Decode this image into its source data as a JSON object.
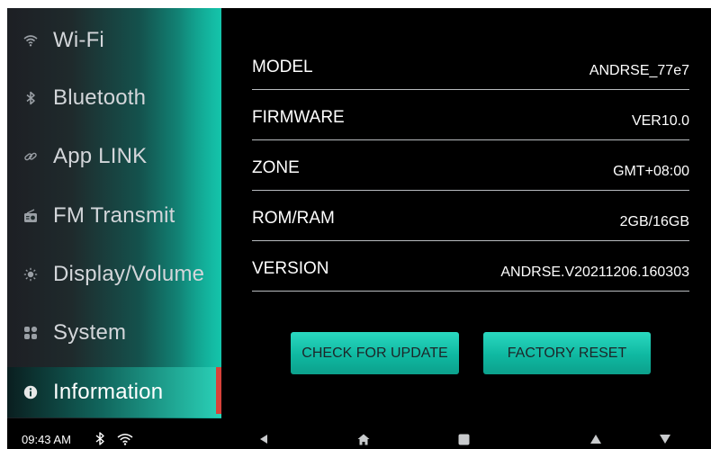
{
  "sidebar": {
    "items": [
      {
        "label": "Wi-Fi",
        "icon": "wifi-icon"
      },
      {
        "label": "Bluetooth",
        "icon": "bluetooth-icon"
      },
      {
        "label": "App LINK",
        "icon": "link-icon"
      },
      {
        "label": "FM Transmit",
        "icon": "radio-icon"
      },
      {
        "label": "Display/Volume",
        "icon": "brightness-icon"
      },
      {
        "label": "System",
        "icon": "system-grid-icon"
      },
      {
        "label": "Information",
        "icon": "info-icon"
      }
    ],
    "active_index": 6
  },
  "info": {
    "rows": [
      {
        "key": "MODEL",
        "value": "ANDRSE_77e7"
      },
      {
        "key": "FIRMWARE",
        "value": "VER10.0"
      },
      {
        "key": "ZONE",
        "value": "GMT+08:00"
      },
      {
        "key": "ROM/RAM",
        "value": "2GB/16GB"
      },
      {
        "key": "VERSION",
        "value": "ANDRSE.V20211206.160303"
      }
    ]
  },
  "buttons": {
    "check_update": "CHECK FOR UPDATE",
    "factory_reset": "FACTORY RESET"
  },
  "statusbar": {
    "time": "09:43 AM",
    "icons": [
      "bluetooth-icon",
      "wifi-icon"
    ]
  },
  "navbar": {
    "buttons": [
      "back-icon",
      "home-icon",
      "recents-icon",
      "volume-up-icon",
      "volume-down-icon"
    ]
  },
  "colors": {
    "accent": "#0fb8a1",
    "active_marker": "#d8423a",
    "background": "#000000"
  }
}
